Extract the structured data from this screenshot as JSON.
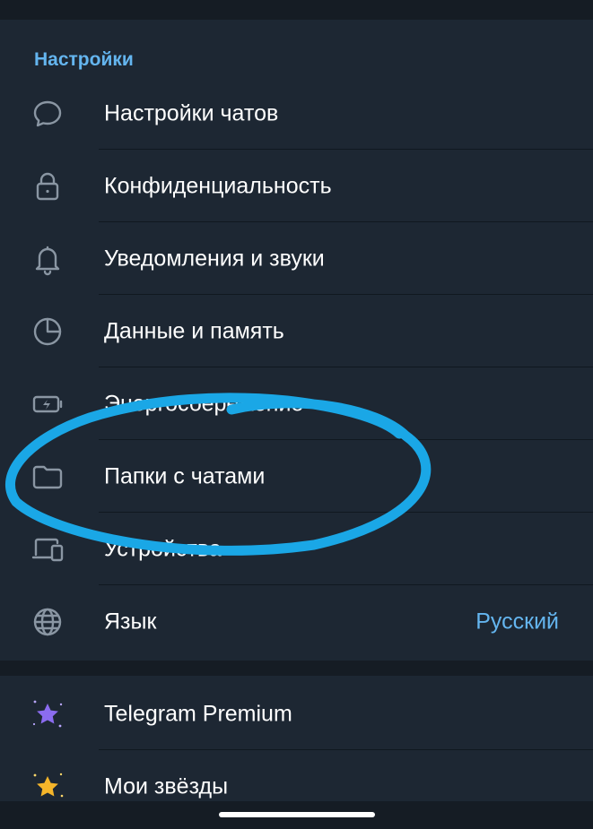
{
  "settings": {
    "title": "Настройки",
    "items": [
      {
        "label": "Настройки чатов",
        "icon": "chat-bubble-icon"
      },
      {
        "label": "Конфиденциальность",
        "icon": "lock-icon"
      },
      {
        "label": "Уведомления и звуки",
        "icon": "bell-icon"
      },
      {
        "label": "Данные и память",
        "icon": "pie-chart-icon"
      },
      {
        "label": "Энергосбережение",
        "icon": "battery-icon"
      },
      {
        "label": "Папки с чатами",
        "icon": "folder-icon"
      },
      {
        "label": "Устройства",
        "icon": "devices-icon"
      },
      {
        "label": "Язык",
        "icon": "globe-icon",
        "value": "Русский"
      }
    ]
  },
  "extras": {
    "items": [
      {
        "label": "Telegram Premium",
        "icon": "premium-star-icon"
      },
      {
        "label": "Мои звёзды",
        "icon": "stars-icon"
      }
    ]
  },
  "colors": {
    "background": "#151c24",
    "section": "#1d2733",
    "accent": "#64b5ef",
    "scribble": "#1aa7e6",
    "premium_star": "#8b6cf0",
    "gold_star": "#f5b52a"
  }
}
